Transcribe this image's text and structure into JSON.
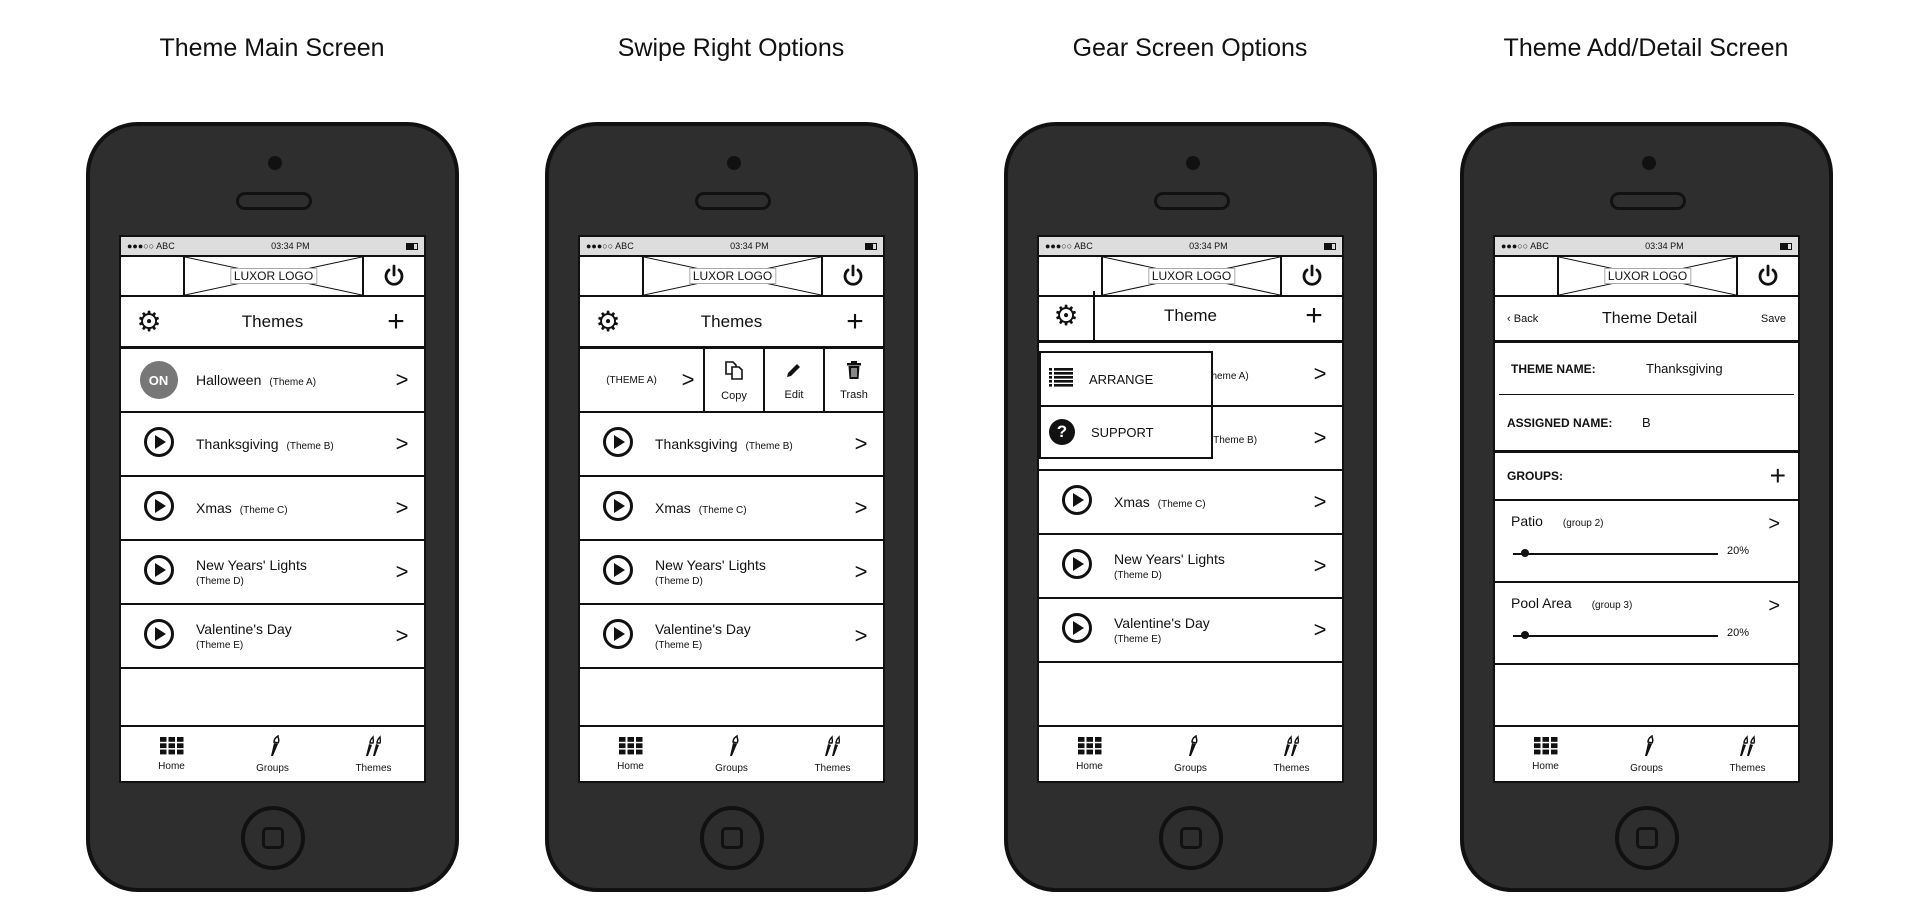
{
  "screens": [
    {
      "title": "Theme Main Screen",
      "variant": "main"
    },
    {
      "title": "Swipe Right Options",
      "variant": "swipe"
    },
    {
      "title": "Gear Screen Options",
      "variant": "gear"
    },
    {
      "title": "Theme Add/Detail Screen",
      "variant": "detail"
    }
  ],
  "status": {
    "carrier": "●●●○○ ABC",
    "time": "03:34 PM"
  },
  "logo": "LUXOR LOGO",
  "themes_bar": {
    "title": "Themes",
    "gear_title": "Theme"
  },
  "on_label": "ON",
  "themes": [
    {
      "name": "Halloween",
      "tag": "(Theme A)",
      "status": "on"
    },
    {
      "name": "Thanksgiving",
      "tag": "(Theme B)"
    },
    {
      "name": "Xmas",
      "tag": "(Theme C)"
    },
    {
      "name": "New Years' Lights",
      "tag": "(Theme D)",
      "two_line": true
    },
    {
      "name": "Valentine's Day",
      "tag": "(Theme E)",
      "two_line": true
    }
  ],
  "swipe": {
    "tag": "(THEME A)",
    "actions": [
      {
        "label": "Copy",
        "icon": "copy-icon"
      },
      {
        "label": "Edit",
        "icon": "pencil-icon"
      },
      {
        "label": "Trash",
        "icon": "trash-icon"
      }
    ]
  },
  "gear_menu": [
    {
      "label": "ARRANGE",
      "icon": "list-icon"
    },
    {
      "label": "SUPPORT",
      "icon": "question-icon"
    }
  ],
  "gear_hidden_fragment": "g",
  "tabs": [
    {
      "label": "Home",
      "icon": "grid-icon"
    },
    {
      "label": "Groups",
      "icon": "torch-icon"
    },
    {
      "label": "Themes",
      "icon": "torches-icon"
    }
  ],
  "detail": {
    "back": "Back",
    "title": "Theme Detail",
    "save": "Save",
    "theme_name_label": "THEME NAME:",
    "theme_name": "Thanksgiving",
    "assigned_label": "ASSIGNED NAME:",
    "assigned": "B",
    "groups_label": "GROUPS:",
    "groups": [
      {
        "name": "Patio",
        "tag": "(group 2)",
        "level": "20%",
        "level_value": 20
      },
      {
        "name": "Pool Area",
        "tag": "(group 3)",
        "level": "20%",
        "level_value": 20
      }
    ]
  }
}
